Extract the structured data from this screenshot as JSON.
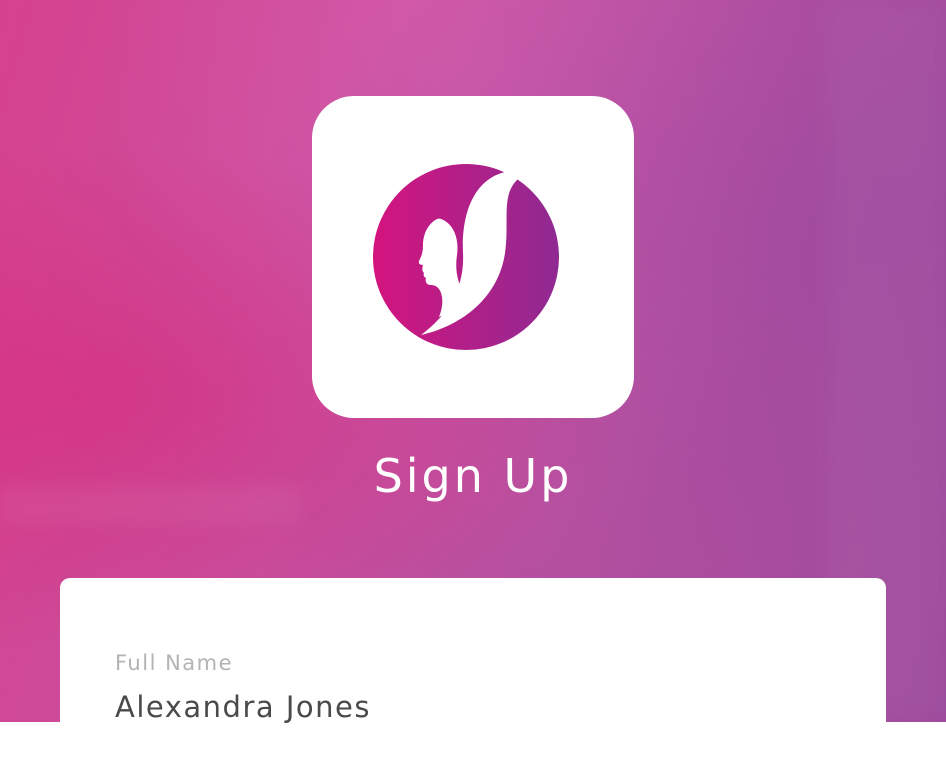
{
  "screen": {
    "title": "Sign Up"
  },
  "logo": {
    "icon": "woman-profile-silhouette-logo",
    "gradient_start": "#d4147e",
    "gradient_end": "#8f2a92"
  },
  "form": {
    "full_name": {
      "label": "Full Name",
      "value": "Alexandra Jones"
    }
  },
  "colors": {
    "background_pink": "#d6428e",
    "background_purple": "#9c4a9c",
    "card": "#ffffff",
    "label": "#b3b3b3",
    "value": "#4a4a4a"
  }
}
